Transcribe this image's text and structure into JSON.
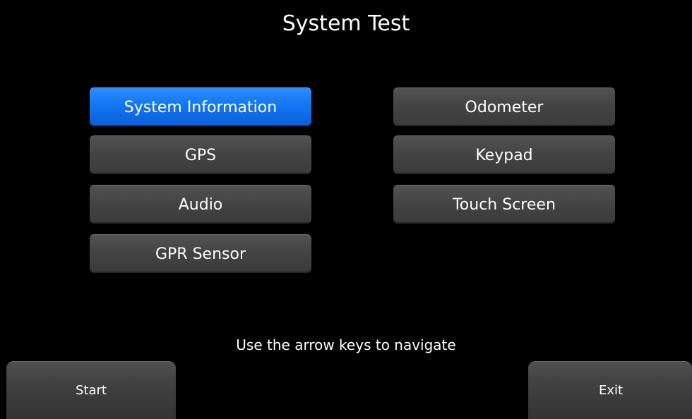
{
  "screen": {
    "title": "System Test",
    "hint": "Use the arrow keys to navigate"
  },
  "menu": {
    "left": [
      {
        "label": "System Information",
        "selected": true
      },
      {
        "label": "GPS",
        "selected": false
      },
      {
        "label": "Audio",
        "selected": false
      },
      {
        "label": "GPR Sensor",
        "selected": false
      }
    ],
    "right": [
      {
        "label": "Odometer",
        "selected": false
      },
      {
        "label": "Keypad",
        "selected": false
      },
      {
        "label": "Touch Screen",
        "selected": false
      }
    ]
  },
  "softkeys": {
    "start_label": "Start",
    "exit_label": "Exit"
  },
  "colors": {
    "background": "#000000",
    "button": "#444444",
    "selected_button": "#1273f0",
    "text": "#ffffff"
  }
}
